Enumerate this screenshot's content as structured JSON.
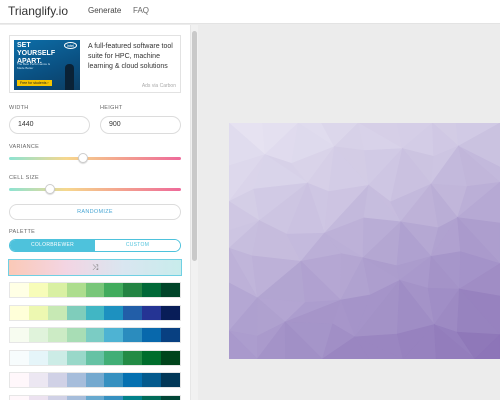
{
  "header": {
    "brand": "Trianglify.io",
    "nav": [
      {
        "label": "Generate"
      },
      {
        "label": "FAQ"
      }
    ]
  },
  "ad": {
    "image_headline": "SET YOURSELF APART.",
    "image_brand": "intel",
    "image_subtext": "The Best Performance Is Made Better",
    "image_cta": "Free for students ›",
    "text": "A full-featured software tool suite for HPC, machine learning & cloud solutions",
    "via": "Ads via Carbon"
  },
  "controls": {
    "width_label": "WIDTH",
    "width_value": "1440",
    "height_label": "HEIGHT",
    "height_value": "900",
    "variance_label": "VARIANCE",
    "variance_value": 0.43,
    "cell_size_label": "CELL SIZE",
    "cell_size_value": 0.24,
    "randomize_label": "RANDOMIZE",
    "palette_label": "PALETTE",
    "palette_tabs": [
      {
        "label": "COLORBREWER",
        "active": true
      },
      {
        "label": "CUSTOM",
        "active": false
      }
    ],
    "shuffle_icon": "shuffle-icon"
  },
  "palettes": [
    [
      "#ffffe5",
      "#f7fcb9",
      "#d9f0a3",
      "#addd8e",
      "#78c679",
      "#41ab5d",
      "#238443",
      "#006837",
      "#004529"
    ],
    [
      "#ffffd9",
      "#edf8b1",
      "#c7e9b4",
      "#7fcdbb",
      "#41b6c4",
      "#1d91c0",
      "#225ea8",
      "#253494",
      "#081d58"
    ],
    [
      "#f7fcf0",
      "#e0f3db",
      "#ccebc5",
      "#a8ddb5",
      "#7bccc4",
      "#4eb3d3",
      "#2b8cbe",
      "#0868ac",
      "#084081"
    ],
    [
      "#f7fcfd",
      "#e5f5f9",
      "#ccece6",
      "#99d8c9",
      "#66c2a4",
      "#41ae76",
      "#238b45",
      "#006d2c",
      "#00441b"
    ],
    [
      "#fff7fb",
      "#ece7f2",
      "#d0d1e6",
      "#a6bddb",
      "#74a9cf",
      "#3690c0",
      "#0570b0",
      "#045a8d",
      "#023858"
    ],
    [
      "#fff7fb",
      "#ece2f0",
      "#d0d1e6",
      "#a6bddb",
      "#67a9cf",
      "#3690c0",
      "#02818a",
      "#016c59",
      "#014636"
    ]
  ],
  "preview": {
    "gradient_colors": [
      "#e9e6f3",
      "#cdc5e2",
      "#a898cb",
      "#8a72b6"
    ]
  }
}
